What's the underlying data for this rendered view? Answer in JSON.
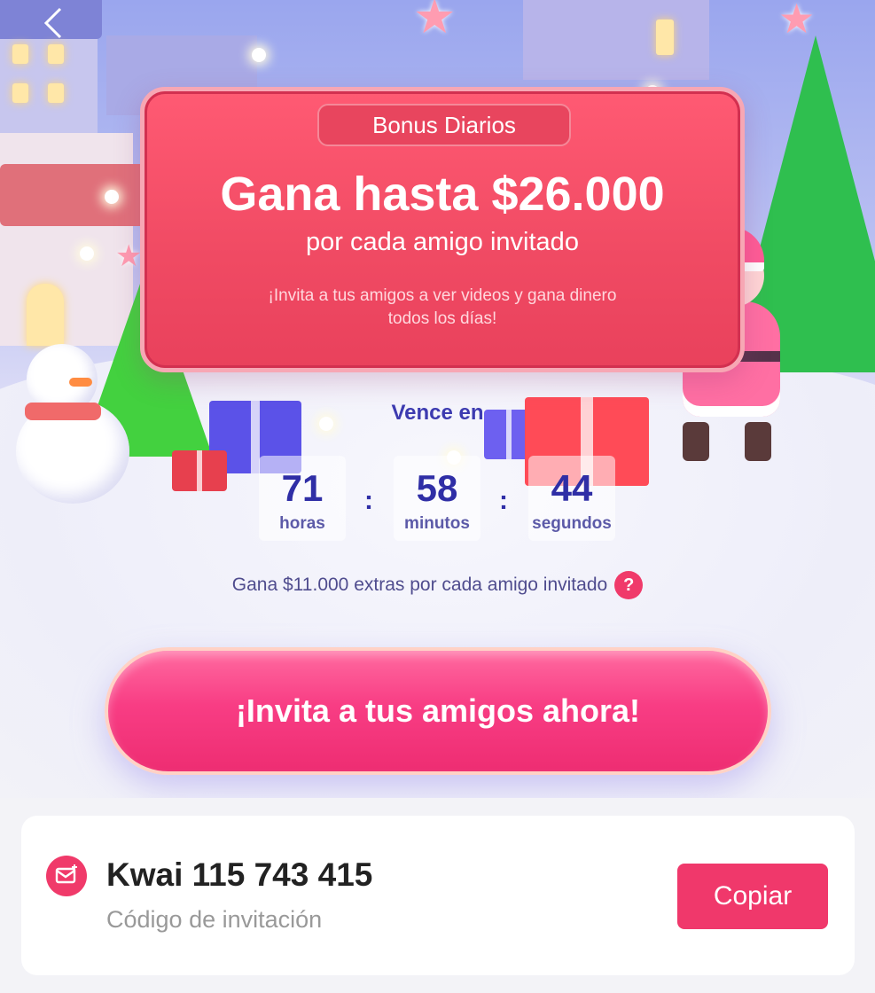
{
  "nav": {
    "back_icon": "chevron-left-icon"
  },
  "sign": {
    "badge": "Bonus Diarios",
    "title": "Gana hasta $26.000",
    "subtitle": "por cada amigo invitado",
    "description": "¡Invita a tus amigos a ver videos y gana dinero todos los días!"
  },
  "countdown": {
    "label": "Vence en",
    "hours_value": "71",
    "hours_unit": "horas",
    "minutes_value": "58",
    "minutes_unit": "minutos",
    "seconds_value": "44",
    "seconds_unit": "segundos",
    "separator": ":"
  },
  "extra": {
    "text": "Gana $11.000 extras por cada amigo invitado",
    "help_icon": "?"
  },
  "invite_button": {
    "label": "¡Invita a tus amigos ahora!"
  },
  "code": {
    "value": "Kwai 115 743 415",
    "label": "Código de invitación",
    "copy_label": "Copiar",
    "icon": "mail-icon"
  },
  "colors": {
    "accent": "#f0386b",
    "sign": "#f04a63",
    "timer_text": "#2f2ea6"
  }
}
